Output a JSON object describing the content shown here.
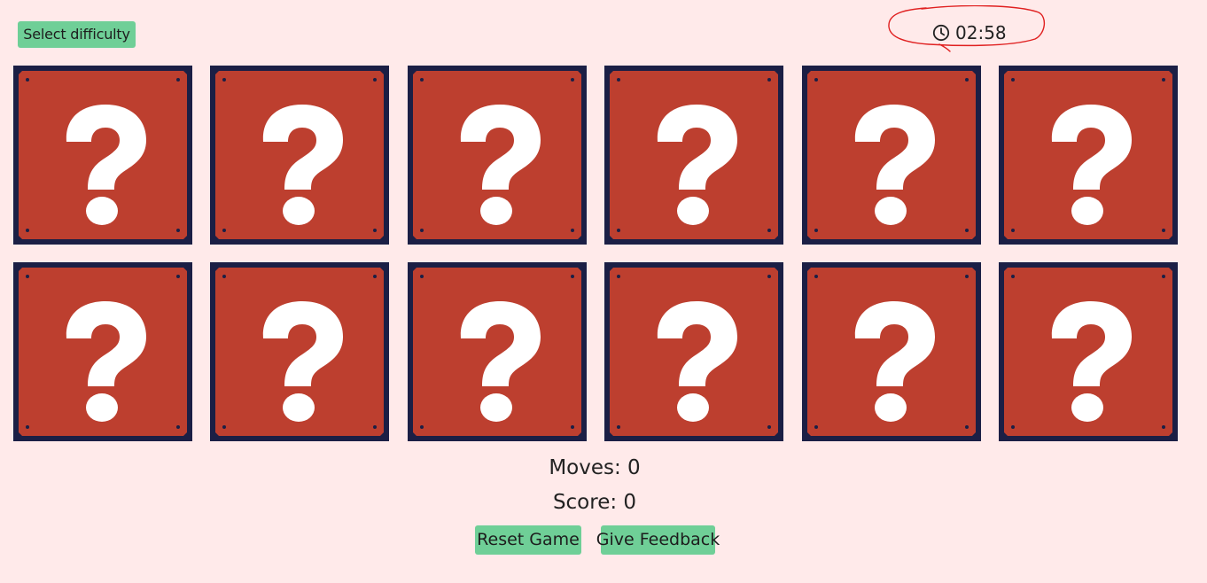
{
  "header": {
    "difficulty_label": "Select difficulty",
    "timer_icon": "clock-icon",
    "timer_value": "02:58"
  },
  "board": {
    "rows": 2,
    "columns": 6,
    "card_count": 12,
    "card_face": "question-mark-block",
    "card_symbol": "?",
    "colors": {
      "card_border": "#1b1f45",
      "card_fill": "#bd3f2f",
      "symbol": "#ffffff"
    }
  },
  "stats": {
    "moves_label": "Moves:",
    "moves_value": "0",
    "score_label": "Score:",
    "score_value": "0"
  },
  "controls": {
    "reset_label": "Reset Game",
    "feedback_label": "Give Feedback"
  },
  "colors": {
    "background": "#ffeaea",
    "button": "#6fcf97",
    "annotation": "#e02020"
  }
}
